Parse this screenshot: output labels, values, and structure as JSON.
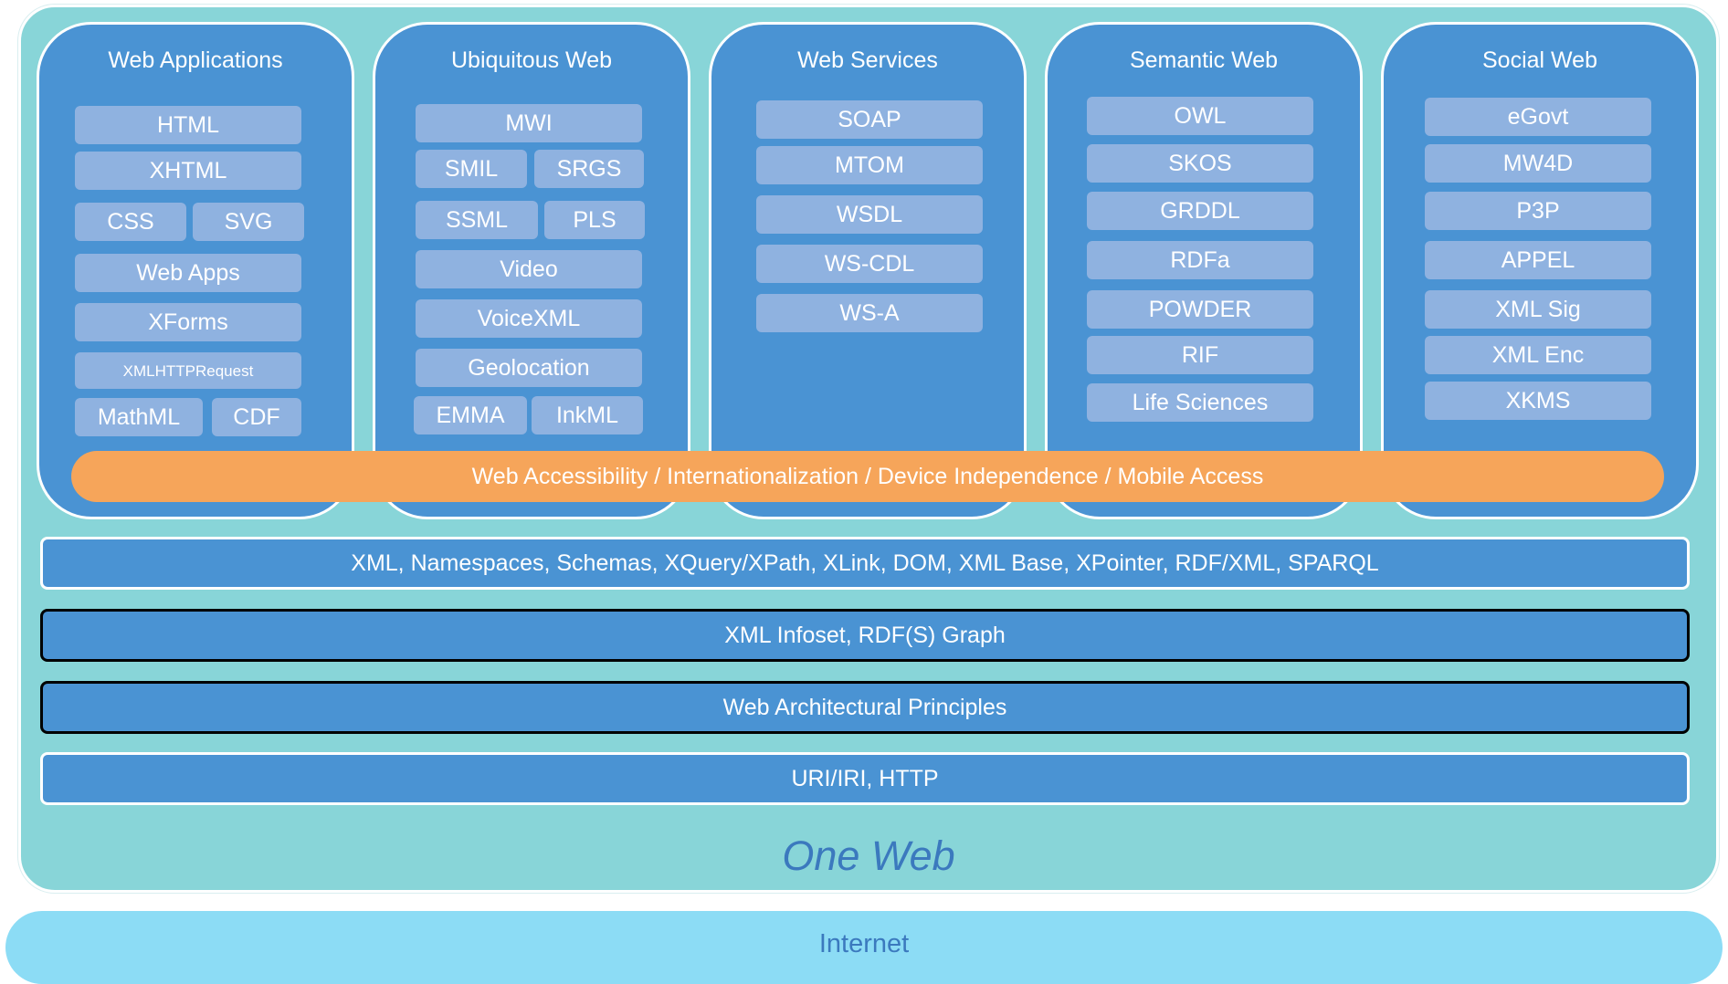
{
  "columns": [
    {
      "title": "Web Applications",
      "items": [
        "HTML",
        "XHTML",
        "CSS",
        "SVG",
        "Web Apps",
        "XForms",
        "XMLHTTPRequest",
        "MathML",
        "CDF"
      ]
    },
    {
      "title": "Ubiquitous Web",
      "items": [
        "MWI",
        "SMIL",
        "SRGS",
        "SSML",
        "PLS",
        "Video",
        "VoiceXML",
        "Geolocation",
        "EMMA",
        "InkML"
      ]
    },
    {
      "title": "Web Services",
      "items": [
        "SOAP",
        "MTOM",
        "WSDL",
        "WS-CDL",
        "WS-A"
      ]
    },
    {
      "title": "Semantic Web",
      "items": [
        "OWL",
        "SKOS",
        "GRDDL",
        "RDFa",
        "POWDER",
        "RIF",
        "Life Sciences"
      ]
    },
    {
      "title": "Social Web",
      "items": [
        "eGovt",
        "MW4D",
        "P3P",
        "APPEL",
        "XML Sig",
        "XML Enc",
        "XKMS"
      ]
    }
  ],
  "band": "Web Accessibility / Internationalization / Device Independence / Mobile Access",
  "layers": [
    "XML, Namespaces, Schemas, XQuery/XPath, XLink, DOM, XML Base, XPointer, RDF/XML, SPARQL",
    "XML Infoset, RDF(S) Graph",
    "Web Architectural Principles",
    "URI/IRI, HTTP"
  ],
  "one_web": "One Web",
  "internet": "Internet",
  "colors": {
    "background": "#88d5d8",
    "column": "#4a93d3",
    "item": "#8fb2e0",
    "band": "#f6a55a",
    "internet": "#8cdcf5",
    "label": "#3b79be"
  }
}
